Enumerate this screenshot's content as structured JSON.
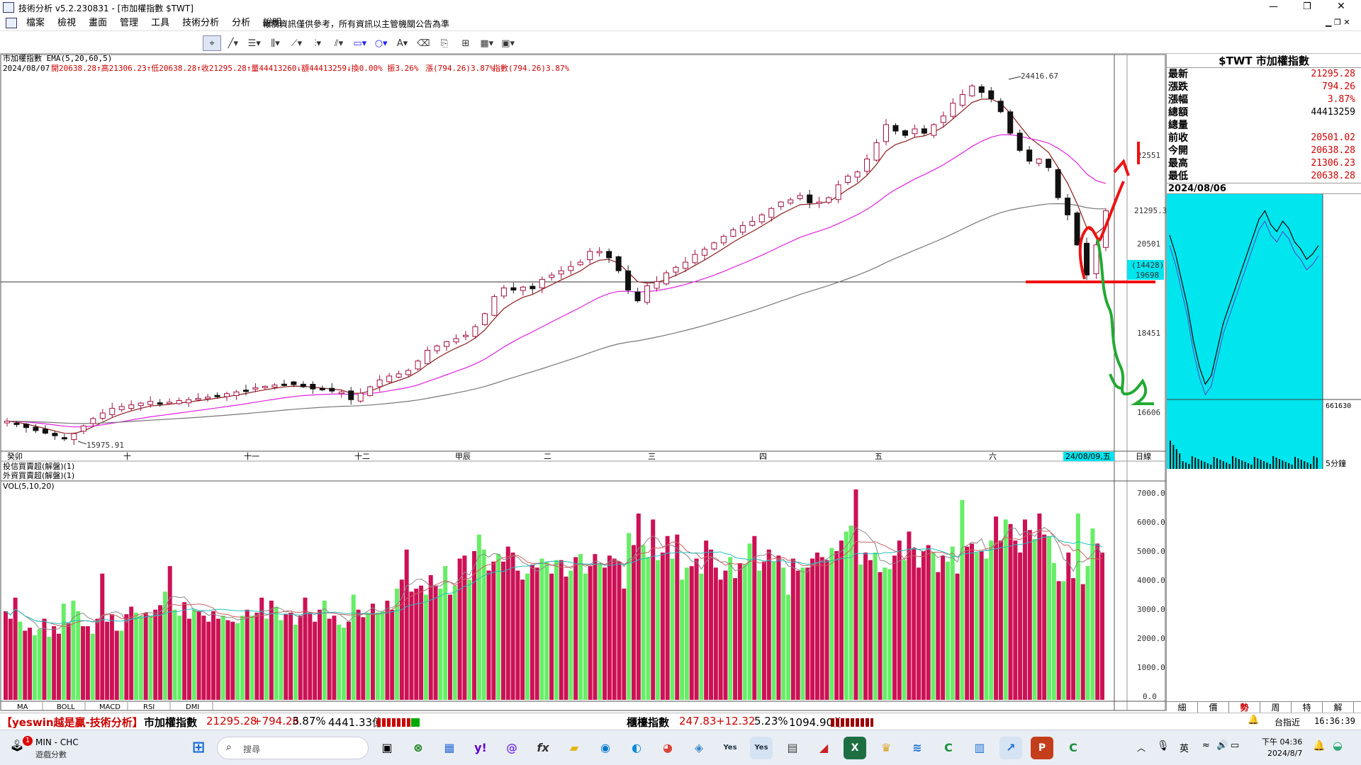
{
  "window": {
    "title": "技術分析 v5.2.230831 - [市加權指數 $TWT]",
    "min_label": "—",
    "max_label": "❐",
    "close_label": "✕",
    "child_controls": "▁ ❐ ✕"
  },
  "menu": {
    "items": [
      "檔案",
      "檢視",
      "畫面",
      "管理",
      "工具",
      "技術分析",
      "分析",
      "說明"
    ],
    "notice": "報價資訊僅供參考，所有資訊以主管機關公告為準"
  },
  "chart": {
    "header_line1": "市加權指數 EMA(5,20,60,5)",
    "header_line2_date": "2024/08/07",
    "header_line2_rest": "開20638.28↑高21306.23↑低20638.28↑收21295.28↑量44413260↓額44413259↓換0.00% 振3.26%",
    "header_change": "漲(794.26)3.87%",
    "header_index": "指數(794.26)3.87%",
    "high_label": "24416.67",
    "low_label": "15975.91",
    "price_axis": [
      "22551",
      "20501",
      "18451",
      "16606"
    ],
    "last_price_tag": "21295.3",
    "crosshair_tag_a": "(14428)",
    "crosshair_tag_b": "19698",
    "month_labels": [
      "癸卯",
      "十",
      "十一",
      "十二",
      "甲辰",
      "二",
      "三",
      "四",
      "五",
      "六"
    ],
    "date_cursor": "24/08/09,五",
    "period_label": "日線",
    "sub1": "投信買賣超(解盤)(1)",
    "sub2": "外資買賣超(解盤)(1)",
    "vol_label": "VOL(5,10,20)",
    "vol_axis": [
      "7000.0",
      "6000.0",
      "5000.0",
      "4000.0",
      "3000.0",
      "2000.0",
      "1000.0",
      "0.0"
    ],
    "indicator_tabs": [
      "MA",
      "BOLL",
      "MACD",
      "RSI",
      "DMI"
    ],
    "colors": {
      "up": "#cc1155",
      "down": "#66ee66",
      "ema5": "#8b1a1a",
      "ema20": "#e020e0",
      "ema60": "#777777",
      "annot_red": "#ee1111",
      "annot_green": "#22aa33",
      "cyan": "#00e5ee"
    }
  },
  "chart_data": {
    "type": "candlestick",
    "title": "市加權指數 $TWT",
    "period": "日線",
    "high": 24416.67,
    "low": 15975.91,
    "last": {
      "date": "2024/08/07",
      "open": 20638.28,
      "high": 21306.23,
      "low": 20638.28,
      "close": 21295.28,
      "volume": 44413260,
      "change": 794.26,
      "pct": "3.87%"
    },
    "ylim": [
      15800,
      24700
    ],
    "closes": [
      16400,
      16330,
      16250,
      16180,
      16120,
      16060,
      16010,
      16110,
      16290,
      16460,
      16590,
      16700,
      16740,
      16780,
      16820,
      16860,
      16800,
      16840,
      16880,
      16900,
      16930,
      16960,
      17000,
      17040,
      17080,
      17120,
      17180,
      17210,
      17240,
      17260,
      17250,
      17200,
      17150,
      17130,
      17100,
      17080,
      16900,
      17050,
      17200,
      17360,
      17450,
      17500,
      17580,
      17800,
      18050,
      18150,
      18250,
      18320,
      18400,
      18600,
      18900,
      19300,
      19500,
      19450,
      19520,
      19480,
      19700,
      19800,
      19900,
      20000,
      20100,
      20350,
      20350,
      20200,
      19900,
      19450,
      19200,
      19550,
      19650,
      19850,
      19980,
      20100,
      20280,
      20400,
      20550,
      20700,
      20850,
      20950,
      21050,
      21200,
      21350,
      21500,
      21550,
      21650,
      21480,
      21500,
      21600,
      21900,
      22100,
      22200,
      22500,
      22880,
      23300,
      23150,
      23050,
      23200,
      23100,
      23300,
      23500,
      23800,
      24000,
      24200,
      24050,
      23900,
      23600,
      23100,
      22700,
      22450,
      22500,
      22300,
      21600,
      21200,
      20500,
      19800,
      20501.02,
      21295.28
    ],
    "volume_y_axis": [
      0,
      1000,
      2000,
      3000,
      4000,
      5000,
      6000,
      7000
    ],
    "volumes": [
      2950,
      2700,
      3400,
      2600,
      2300,
      2400,
      2150,
      2350,
      2700,
      2100,
      2450,
      2200,
      3200,
      2550,
      3300,
      2950,
      2450,
      2450,
      2200,
      2700,
      4200,
      2600,
      2850,
      2300,
      2300,
      2850,
      3100,
      2900,
      2800,
      2900,
      2800,
      3000,
      3150,
      3600,
      4450,
      3000,
      2800,
      3250,
      2700,
      3000,
      2950,
      2800,
      2600,
      2950,
      2700,
      2800,
      2650,
      2600,
      2550,
      2800,
      3000,
      2800,
      2900,
      3400,
      2700,
      3300,
      3100,
      2650,
      2850,
      2900,
      2500,
      2800,
      3400,
      2900,
      2600,
      3000,
      3300,
      2700,
      2800,
      2500,
      2400,
      2600,
      3500,
      3000,
      2750,
      2900,
      3200,
      2900,
      2950,
      3300,
      3000,
      3700,
      4000,
      5000,
      3600,
      3700,
      3800,
      3500,
      4150,
      3800,
      3700,
      4450,
      3500,
      3800,
      4700,
      4800,
      4000,
      4950,
      5500,
      5000,
      4300,
      4600,
      4850,
      4600,
      5100,
      4900,
      4300,
      4000,
      4200,
      4500,
      4400,
      4700,
      4600,
      4200,
      4650,
      4650,
      4100,
      4300,
      4750,
      4850,
      4200,
      4450,
      4850,
      4550,
      4400,
      4800,
      4700,
      4600,
      3700,
      5550,
      5150,
      6200,
      5150,
      4750,
      6000,
      4650,
      4900,
      5450,
      4700,
      5500,
      4000,
      4400,
      4450,
      4700,
      4200,
      5300,
      5000,
      4400,
      4000,
      4300,
      4750,
      4050,
      4550,
      4500,
      5200,
      5450,
      4300,
      4600,
      5000,
      4600,
      4800,
      4400,
      3500,
      4700,
      4300,
      4400,
      4400,
      4700,
      4900,
      4750,
      4650,
      5050,
      4950,
      5300,
      5600,
      5800,
      7000,
      4500,
      4900,
      4650,
      4900,
      4250,
      4400,
      4350,
      4800,
      5300,
      4650,
      5600,
      5050,
      4400,
      4950,
      5150,
      4900,
      4250,
      4800,
      4600,
      5100,
      4200,
      6650,
      5100,
      5200,
      4900,
      4950,
      4700,
      5300,
      6100,
      5300,
      6000,
      5850,
      5300,
      4900,
      6000,
      5650,
      5350,
      6200,
      5500,
      5450,
      4550,
      3950,
      3950,
      4900,
      4050,
      6200,
      3850,
      4450,
      5700,
      5200,
      4900
    ],
    "intraday": {
      "date": "2024/08/06",
      "y_axis": [
        20751,
        20678,
        20606,
        20533,
        20461,
        20388,
        20315,
        20243,
        20170,
        20098,
        20025,
        19953,
        19880,
        19807,
        19735,
        19662
      ],
      "vol_max_label": "661630",
      "interval_label": "5分鐘"
    }
  },
  "annotations": {
    "bounce_arrow": "red",
    "drop_arrow": "green",
    "support_line": "red"
  },
  "quote_panel": {
    "title": "$TWT 市加權指數",
    "rows": [
      {
        "label": "最新",
        "value": "21295.28"
      },
      {
        "label": "漲跌",
        "value": "794.26"
      },
      {
        "label": "漲幅",
        "value": "3.87%"
      },
      {
        "label": "總額",
        "value": "44413259"
      },
      {
        "label": "總量",
        "value": ""
      },
      {
        "label": "前收",
        "value": "20501.02"
      },
      {
        "label": "今開",
        "value": "20638.28"
      },
      {
        "label": "最高",
        "value": "21306.23"
      },
      {
        "label": "最低",
        "value": "20638.28"
      }
    ],
    "intraday_date": "2024/08/06",
    "tabs": [
      "細",
      "價",
      "勢",
      "周",
      "特",
      "解"
    ]
  },
  "statusbar": {
    "slogan": "【yeswin越是贏-技術分析】",
    "index1_name": "市加權指數",
    "index1_value": "21295.28",
    "index1_change": "+794.26",
    "index1_pct": "3.87%",
    "index1_amount": "4441.33億",
    "index2_name": "櫃檯指數",
    "index2_value": "247.83",
    "index2_change": "+12.32",
    "index2_pct": "5.23%",
    "index2_amount": "1094.90億",
    "market": "台指近",
    "clock": "16:36:39"
  },
  "taskbar": {
    "game_title": "MIN - CHC",
    "game_sub": "遊戲分數",
    "badge": "1",
    "search_placeholder": "搜尋",
    "ime": "英",
    "time": "下午 04:36",
    "date": "2024/8/7"
  }
}
